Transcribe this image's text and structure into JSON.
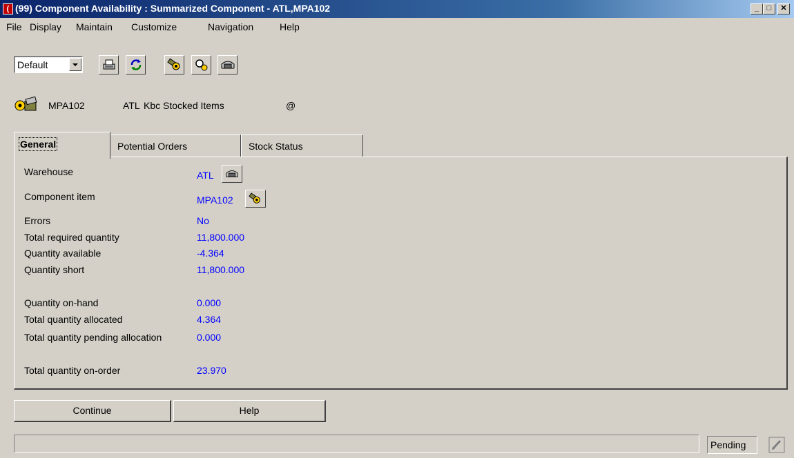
{
  "window": {
    "app_icon_glyph": "(",
    "title": "(99) Component Availability : Summarized Component - ATL,MPA102",
    "minimize_glyph": "_",
    "maximize_glyph": "□",
    "close_glyph": "✕"
  },
  "menu": [
    "File",
    "Display",
    "Maintain",
    "Customize",
    "Navigation",
    "Help"
  ],
  "toolbar": {
    "view_select": "Default",
    "buttons": [
      "printer-icon",
      "refresh-icon",
      "item-icon",
      "search-item-icon",
      "warehouse-icon"
    ]
  },
  "header": {
    "item": "MPA102",
    "warehouse": "ATL",
    "description": "Kbc Stocked Items",
    "symbol": "@"
  },
  "tabs": [
    "General",
    "Potential Orders",
    "Stock Status"
  ],
  "general": {
    "warehouse_label": "Warehouse",
    "warehouse_value": "ATL",
    "component_label": "Component item",
    "component_value": "MPA102",
    "errors_label": "Errors",
    "errors_value": "No",
    "total_required_label": "Total required quantity",
    "total_required_value": "11,800.000",
    "qty_available_label": "Quantity available",
    "qty_available_value": "-4.364",
    "qty_short_label": "Quantity short",
    "qty_short_value": "11,800.000",
    "qty_onhand_label": "Quantity on-hand",
    "qty_onhand_value": "0.000",
    "total_allocated_label": "Total quantity allocated",
    "total_allocated_value": "4.364",
    "pending_alloc_label": "Total quantity pending allocation",
    "pending_alloc_value": "0.000",
    "on_order_label": "Total quantity on-order",
    "on_order_value": "23.970"
  },
  "buttons": {
    "continue": "Continue",
    "help": "Help"
  },
  "status": {
    "text": "",
    "mode": "Pending"
  },
  "colors": {
    "value_text": "#0000ff",
    "title_bar": "#0a246a",
    "face": "#d4d0c8"
  }
}
